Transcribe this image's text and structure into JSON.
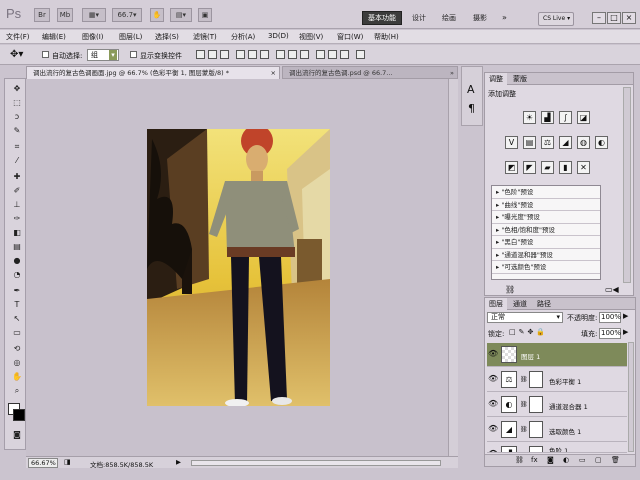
{
  "app": {
    "logo": "Ps",
    "zoom_display": "66.7",
    "workspace_active": "基本功能",
    "workspaces": [
      "设计",
      "绘画",
      "摄影"
    ],
    "more": "»",
    "cs_live": "CS Live",
    "win_controls": [
      "–",
      "□",
      "×"
    ]
  },
  "menubar": {
    "items": [
      "文件(F)",
      "编辑(E)",
      "图像(I)",
      "图层(L)",
      "选择(S)",
      "滤镜(T)",
      "分析(A)",
      "3D(D)",
      "视图(V)",
      "窗口(W)",
      "帮助(H)"
    ]
  },
  "options": {
    "auto_select_label": "自动选择:",
    "auto_select_value": "组",
    "show_transform_label": "显示变换控件"
  },
  "doc_tabs": [
    {
      "label": "调出流行的复古色调画面.jpg @ 66.7% (色彩平衡 1, 图层蒙版/8) *",
      "close": "×"
    },
    {
      "label": "调出流行的复古色调.psd @ 66.7...",
      "close": "»"
    }
  ],
  "status": {
    "zoom": "66.67%",
    "doc_info": "文档:858.5K/858.5K"
  },
  "adjustments": {
    "tabs": [
      "调整",
      "蒙版"
    ],
    "title": "添加调整",
    "presets": [
      "\"色阶\"预设",
      "\"曲线\"预设",
      "\"曝光度\"预设",
      "\"色相/饱和度\"预设",
      "\"黑白\"预设",
      "\"通道混和器\"预设",
      "\"可选颜色\"预设"
    ]
  },
  "layers": {
    "tabs": [
      "图层",
      "通道",
      "路径"
    ],
    "blend_mode": "正常",
    "opacity_label": "不透明度:",
    "opacity": "100%",
    "lock_label": "锁定:",
    "fill_label": "填充:",
    "fill": "100%",
    "items": [
      {
        "name": "图层 1",
        "selected": true,
        "thumb": "",
        "has_mask": false
      },
      {
        "name": "色彩平衡 1",
        "selected": false,
        "thumb": "⚖",
        "has_mask": true
      },
      {
        "name": "通道混合器 1",
        "selected": false,
        "thumb": "◐",
        "has_mask": true
      },
      {
        "name": "选取颜色 1",
        "selected": false,
        "thumb": "◢",
        "has_mask": true
      },
      {
        "name": "色阶 1",
        "selected": false,
        "thumb": "▟",
        "has_mask": true
      }
    ]
  },
  "colors": {
    "accent_selected_layer": "#7e8a5a",
    "workspace_button": "#3c3c3c",
    "photo_tone": "#e9c440"
  }
}
